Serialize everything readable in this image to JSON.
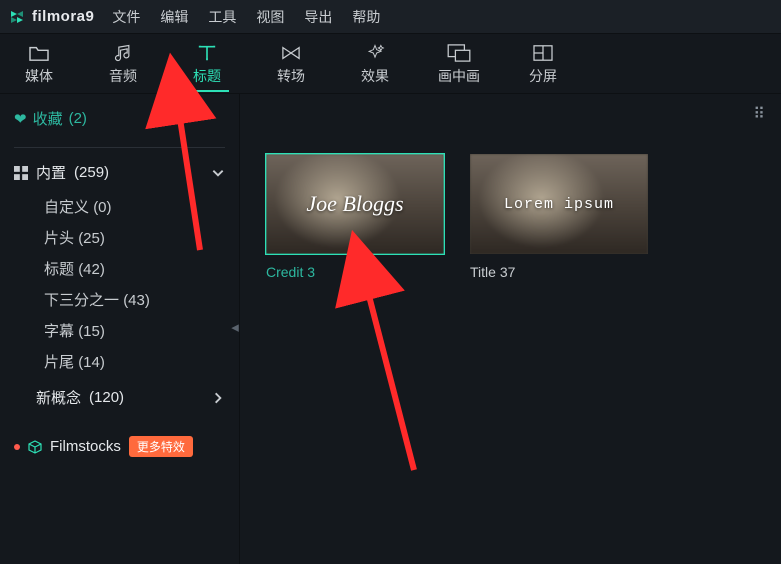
{
  "app": {
    "name": "filmora",
    "version": "9"
  },
  "menu": [
    "文件",
    "编辑",
    "工具",
    "视图",
    "导出",
    "帮助"
  ],
  "toolbar": [
    {
      "id": "media",
      "label": "媒体"
    },
    {
      "id": "audio",
      "label": "音频"
    },
    {
      "id": "title",
      "label": "标题",
      "active": true
    },
    {
      "id": "transition",
      "label": "转场"
    },
    {
      "id": "effect",
      "label": "效果"
    },
    {
      "id": "pip",
      "label": "画中画"
    },
    {
      "id": "split",
      "label": "分屏"
    }
  ],
  "sidebar": {
    "favorites": {
      "label": "收藏",
      "count": "(2)"
    },
    "builtin": {
      "label": "内置",
      "count": "(259)",
      "expanded": true
    },
    "subcats": [
      {
        "label": "自定义",
        "count": "(0)"
      },
      {
        "label": "片头",
        "count": "(25)"
      },
      {
        "label": "标题",
        "count": "(42)"
      },
      {
        "label": "下三分之一",
        "count": "(43)"
      },
      {
        "label": "字幕",
        "count": "(15)"
      },
      {
        "label": "片尾",
        "count": "(14)"
      }
    ],
    "newconcept": {
      "label": "新概念",
      "count": "(120)",
      "expanded": false
    },
    "filmstocks": {
      "label": "Filmstocks",
      "badge": "更多特效"
    }
  },
  "content": {
    "items": [
      {
        "caption": "Credit 3",
        "overlay": "Joe Bloggs",
        "selected": true,
        "style": "t1"
      },
      {
        "caption": "Title 37",
        "overlay": "Lorem ipsum",
        "selected": false,
        "style": "t2"
      }
    ]
  }
}
